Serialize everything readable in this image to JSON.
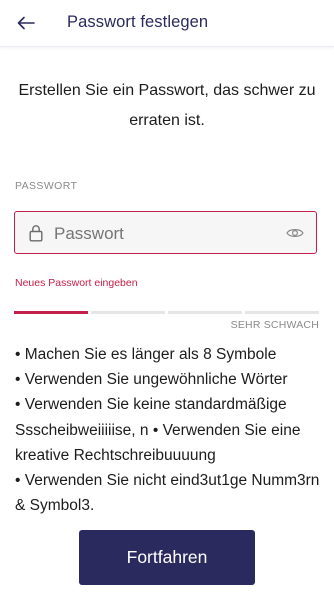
{
  "header": {
    "back_icon": "arrow-left-icon",
    "title": "Passwort festlegen"
  },
  "intro": {
    "text": "Erstellen Sie ein Passwort, das schwer zu erraten ist."
  },
  "password_field": {
    "label": "PASSWORT",
    "placeholder": "Passwort",
    "value": "",
    "lock_icon": "lock-icon",
    "visibility_icon": "eye-icon",
    "error": "Neues Passwort eingeben"
  },
  "strength": {
    "label": "SEHR SCHWACH",
    "level": 1,
    "max_level": 4,
    "active_color": "#c41e4a"
  },
  "tips": {
    "text": "• Machen Sie es länger als 8 Symbole\n • Verwenden Sie ungewöhnliche Wörter\n • Verwenden Sie keine standardmäßige Ssscheibweiiiiise, n • Verwenden Sie eine kreative Rechtschreibuuuung\n• Verwenden Sie nicht eind3ut1ge Numm3rn & Symbol3."
  },
  "actions": {
    "continue_label": "Fortfahren",
    "continue_color": "#2b2a5e"
  },
  "colors": {
    "accent_error": "#c41e4a",
    "header_title": "#2a2a5e"
  }
}
